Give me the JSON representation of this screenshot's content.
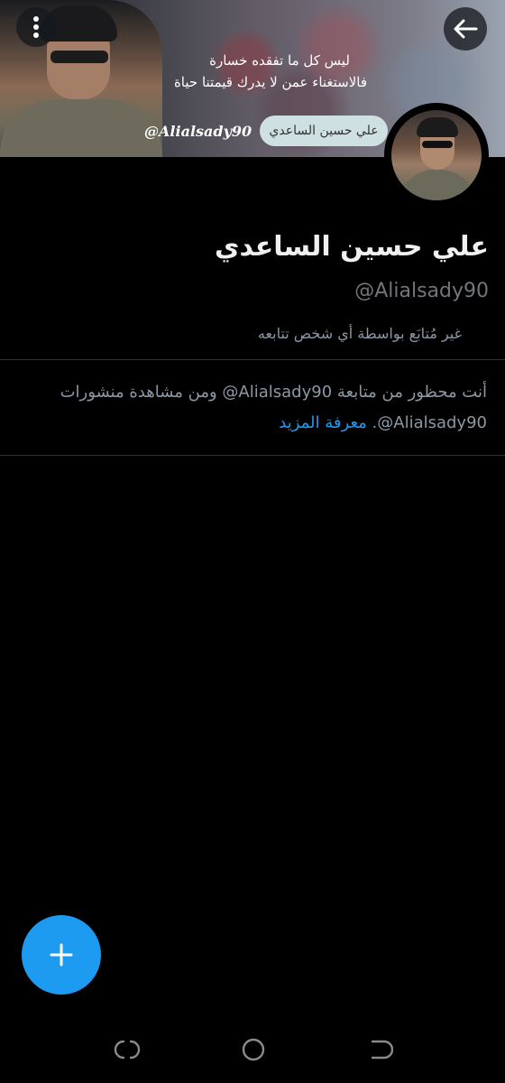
{
  "header": {
    "banner_quote_line1": "ليس كل ما تفقده خسارة",
    "banner_quote_line2": "فالاستغناء عمن لا يدرك قيمتنا حياة",
    "banner_watermark": "@Alialsady90",
    "banner_name_bubble": "علي حسين الساعدي",
    "menu_icon": "more-vertical-icon",
    "back_icon": "arrow-left-icon"
  },
  "profile": {
    "display_name": "علي حسين الساعدي",
    "username": "@Alialsady90",
    "followed_by": "غير مُتابَع بواسطة أي شخص تتابعه"
  },
  "blocked_notice": {
    "text": "أنت محظور من متابعة Alialsady90@ ومن مشاهدة منشورات Alialsady90@.",
    "learn_more": "معرفة المزيد"
  },
  "fab": {
    "icon": "plus-icon"
  },
  "system_nav": {
    "recent": "recent-apps-icon",
    "home": "home-icon",
    "back": "back-icon"
  },
  "colors": {
    "accent": "#1d9bf0",
    "background": "#000000",
    "secondary_text": "#71767b"
  }
}
